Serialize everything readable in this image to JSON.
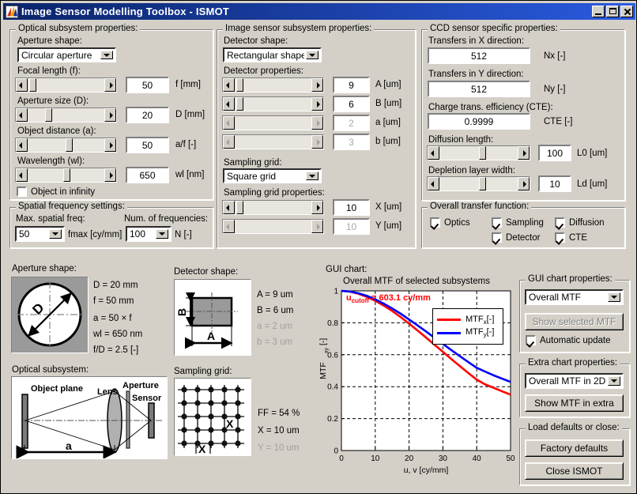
{
  "window": {
    "title": "Image Sensor Modelling Toolbox - ISMOT",
    "icon": "matlab-icon",
    "minimize": "minimize-icon",
    "maximize": "maximize-icon",
    "close": "close-icon"
  },
  "optical": {
    "group_title": "Optical subsystem properties:",
    "aperture_shape_label": "Aperture shape:",
    "aperture_shape_value": "Circular aperture",
    "focal_label": "Focal length (f):",
    "focal_value": "50",
    "focal_unit": "f [mm]",
    "aperture_size_label": "Aperture size (D):",
    "aperture_size_value": "20",
    "aperture_size_unit": "D [mm]",
    "object_distance_label": "Object distance (a):",
    "object_distance_value": "50",
    "object_distance_unit": "a/f [-]",
    "wavelength_label": "Wavelength (wl):",
    "wavelength_value": "650",
    "wavelength_unit": "wl [nm]",
    "infinity_checkbox": "Object in infinity"
  },
  "spatial": {
    "group_title": "Spatial frequency settings:",
    "max_freq_label": "Max. spatial freq:",
    "max_freq_value": "50",
    "max_freq_unit": "fmax [cy/mm]",
    "num_freq_label": "Num. of frequencies:",
    "num_freq_value": "100",
    "num_freq_unit": "N [-]"
  },
  "sensor": {
    "group_title": "Image sensor subsystem properties:",
    "detector_shape_label": "Detector shape:",
    "detector_shape_value": "Rectangular shape",
    "detector_props_label": "Detector properties:",
    "rows": [
      {
        "value": "9",
        "unit": "A [um]",
        "enabled": true
      },
      {
        "value": "6",
        "unit": "B [um]",
        "enabled": true
      },
      {
        "value": "2",
        "unit": "a [um]",
        "enabled": false
      },
      {
        "value": "3",
        "unit": "b [um]",
        "enabled": false
      }
    ],
    "sampling_grid_label": "Sampling grid:",
    "sampling_grid_value": "Square grid",
    "sampling_props_label": "Sampling grid properties:",
    "grid_rows": [
      {
        "value": "10",
        "unit": "X [um]",
        "enabled": true
      },
      {
        "value": "10",
        "unit": "Y [um]",
        "enabled": false
      }
    ]
  },
  "ccd": {
    "group_title": "CCD sensor specific properties:",
    "nx_label": "Transfers in X direction:",
    "nx_value": "512",
    "nx_unit": "Nx [-]",
    "ny_label": "Transfers in Y direction:",
    "ny_value": "512",
    "ny_unit": "Ny [-]",
    "cte_label": "Charge trans. efficiency (CTE):",
    "cte_value": "0.9999",
    "cte_unit": "CTE [-]",
    "diffusion_label": "Diffusion length:",
    "diffusion_value": "100",
    "diffusion_unit": "L0 [um]",
    "depletion_label": "Depletion layer width:",
    "depletion_value": "10",
    "depletion_unit": "Ld [um]"
  },
  "transfer": {
    "group_title": "Overall transfer function:",
    "items": [
      {
        "label": "Optics",
        "checked": true
      },
      {
        "label": "Sampling",
        "checked": true
      },
      {
        "label": "Diffusion",
        "checked": true
      },
      {
        "label": "Detector",
        "checked": true
      },
      {
        "label": "CTE",
        "checked": true
      }
    ]
  },
  "aperture_preview": {
    "caption": "Aperture shape:",
    "glyph": "D",
    "values": [
      {
        "text": "D = 20 mm",
        "dim": false
      },
      {
        "text": "f = 50 mm",
        "dim": false
      },
      {
        "text": "a = 50 × f",
        "dim": false
      },
      {
        "text": "wl = 650 nm",
        "dim": false
      },
      {
        "text": "f/D = 2.5 [-]",
        "dim": false
      }
    ]
  },
  "detector_preview": {
    "caption": "Detector shape:",
    "glyph_a": "A",
    "glyph_b": "B",
    "values": [
      {
        "text": "A = 9 um",
        "dim": false
      },
      {
        "text": "B = 6 um",
        "dim": false
      },
      {
        "text": "a = 2 um",
        "dim": true
      },
      {
        "text": "b = 3 um",
        "dim": true
      }
    ]
  },
  "optical_preview": {
    "caption": "Optical subsystem:",
    "labels": {
      "object_plane": "Object plane",
      "lens": "Lens",
      "aperture": "Aperture",
      "sensor": "Sensor",
      "distance": "a"
    }
  },
  "grid_preview": {
    "caption": "Sampling grid:",
    "glyph_x_right": "X",
    "glyph_x_bottom": "X",
    "values": [
      {
        "text": "FF = 54 %",
        "dim": false
      },
      {
        "text": "X = 10 um",
        "dim": false
      },
      {
        "text": "Y = 10 um",
        "dim": true
      }
    ]
  },
  "gui_chart_label": "GUI chart:",
  "chart_data": {
    "type": "line",
    "title": "Overall MTF of selected subsystems",
    "xlabel": "u, v [cy/mm]",
    "ylabel": "MTF_xy [-]",
    "xlim": [
      0,
      50
    ],
    "ylim": [
      0,
      1
    ],
    "xticks": [
      0,
      10,
      20,
      30,
      40,
      50
    ],
    "yticks": [
      0,
      0.2,
      0.4,
      0.6,
      0.8,
      1
    ],
    "grid": true,
    "legend_position": "upper-right",
    "annotation": "u_cutoff = 603.1 cy/mm",
    "annotation_color": "#ff0000",
    "x": [
      0,
      2.5,
      5,
      7.5,
      10,
      12.5,
      15,
      17.5,
      20,
      22.5,
      25,
      27.5,
      30,
      32.5,
      35,
      37.5,
      40,
      42.5,
      45,
      47.5,
      50
    ],
    "series": [
      {
        "name": "MTF_x [-]",
        "legend": "MTFx [-]",
        "color": "#ff0000",
        "values": [
          1.0,
          0.995,
          0.982,
          0.963,
          0.938,
          0.908,
          0.874,
          0.836,
          0.795,
          0.752,
          0.708,
          0.663,
          0.618,
          0.573,
          0.529,
          0.486,
          0.444,
          0.414,
          0.393,
          0.371,
          0.35
        ]
      },
      {
        "name": "MTF_y [-]",
        "legend": "MTFy [-]",
        "color": "#0000ff",
        "values": [
          1.0,
          0.996,
          0.985,
          0.969,
          0.947,
          0.92,
          0.89,
          0.857,
          0.821,
          0.784,
          0.746,
          0.707,
          0.668,
          0.629,
          0.591,
          0.554,
          0.518,
          0.494,
          0.471,
          0.45,
          0.43
        ]
      }
    ]
  },
  "gui_chart_props": {
    "group_title": "GUI chart properties:",
    "select_value": "Overall MTF",
    "show_button": "Show selected MTF",
    "auto_update": "Automatic update",
    "auto_update_checked": true
  },
  "extra_chart_props": {
    "group_title": "Extra chart properties:",
    "select_value": "Overall MTF in 2D",
    "show_button": "Show MTF in extra"
  },
  "defaults": {
    "group_title": "Load defaults or close:",
    "factory_button": "Factory defaults",
    "close_button": "Close ISMOT"
  }
}
